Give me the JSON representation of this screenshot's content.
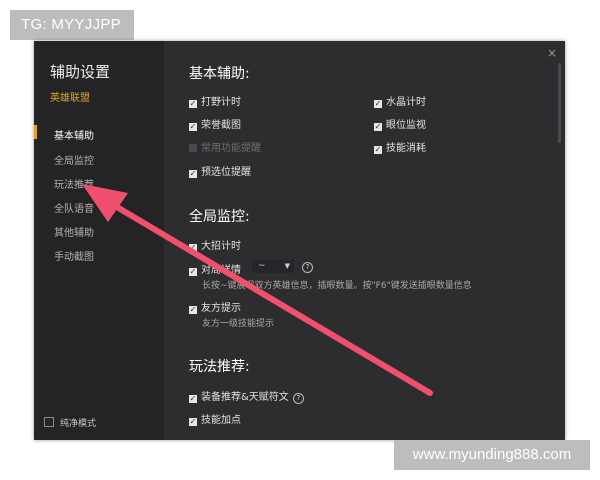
{
  "watermarks": {
    "top_left": "TG: MYYJJPP",
    "bottom_right": "www.myunding888.com"
  },
  "sidebar": {
    "title": "辅助设置",
    "subtitle": "英雄联盟",
    "items": [
      {
        "label": "基本辅助",
        "active": true
      },
      {
        "label": "全局监控",
        "active": false
      },
      {
        "label": "玩法推荐",
        "active": false
      },
      {
        "label": "全队语音",
        "active": false
      },
      {
        "label": "其他辅助",
        "active": false
      },
      {
        "label": "手动截图",
        "active": false
      }
    ],
    "pure_mode": "纯净模式"
  },
  "window": {
    "close": "×"
  },
  "basic": {
    "title": "基本辅助:",
    "options": [
      {
        "label": "打野计时",
        "checked": true
      },
      {
        "label": "水晶计时",
        "checked": true
      },
      {
        "label": "荣誉截图",
        "checked": true
      },
      {
        "label": "眼位监视",
        "checked": true
      },
      {
        "label": "常用功能提醒",
        "checked": false,
        "disabled": true
      },
      {
        "label": "技能消耗",
        "checked": true
      },
      {
        "label": "预选位提醒",
        "checked": true
      }
    ]
  },
  "global": {
    "title": "全局监控:",
    "ult_timer": "大招计时",
    "detail": "对局详情",
    "detail_value": "~",
    "detail_hint": "长按~键展现双方英雄信息，插眼数量。按\"F6\"键发送插眼数量信息",
    "ally_tip": "友方提示",
    "ally_hint": "友方一级技能提示"
  },
  "play": {
    "title": "玩法推荐:",
    "equip": "装备推荐&天赋符文",
    "skill": "技能加点"
  },
  "icons": {
    "check": "check-icon",
    "help": "help-circle-icon",
    "close": "close-icon",
    "arrow": "red-arrow"
  },
  "colors": {
    "accent": "#e0a41e",
    "arrow": "#f0506e",
    "window_bg": "#2d2d30",
    "sidebar_bg": "#242427"
  }
}
